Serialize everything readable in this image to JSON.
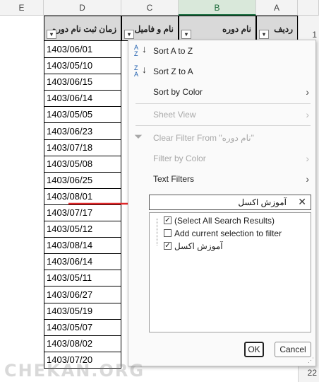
{
  "columns": [
    "E",
    "D",
    "C",
    "B",
    "A"
  ],
  "row_numbers": [
    "1",
    "22"
  ],
  "headers": {
    "d": "زمان ثبت نام دوره",
    "c": "نام و فامیل",
    "b": "نام دوره",
    "a": "ردیف"
  },
  "dates": [
    "1403/06/01",
    "1403/05/10",
    "1403/06/15",
    "1403/06/14",
    "1403/05/05",
    "1403/06/23",
    "1403/07/18",
    "1403/05/08",
    "1403/06/25",
    "1403/08/01",
    "1403/07/17",
    "1403/05/12",
    "1403/08/14",
    "1403/06/14",
    "1403/05/11",
    "1403/06/27",
    "1403/05/19",
    "1403/05/07",
    "1403/08/02",
    "1403/07/20"
  ],
  "menu": {
    "sort_az": "Sort A to Z",
    "sort_za": "Sort Z to A",
    "sort_color": "Sort by Color",
    "sheet_view": "Sheet View",
    "clear_filter": "Clear Filter From \"نام دوره\"",
    "filter_color": "Filter by Color",
    "text_filters": "Text Filters",
    "search_value": "آموزش اکسل",
    "items": [
      "(Select All Search Results)",
      "Add current selection to filter",
      "آموزش اکسل"
    ],
    "ok": "OK",
    "cancel": "Cancel"
  },
  "watermark": "CHEKAN.ORG"
}
